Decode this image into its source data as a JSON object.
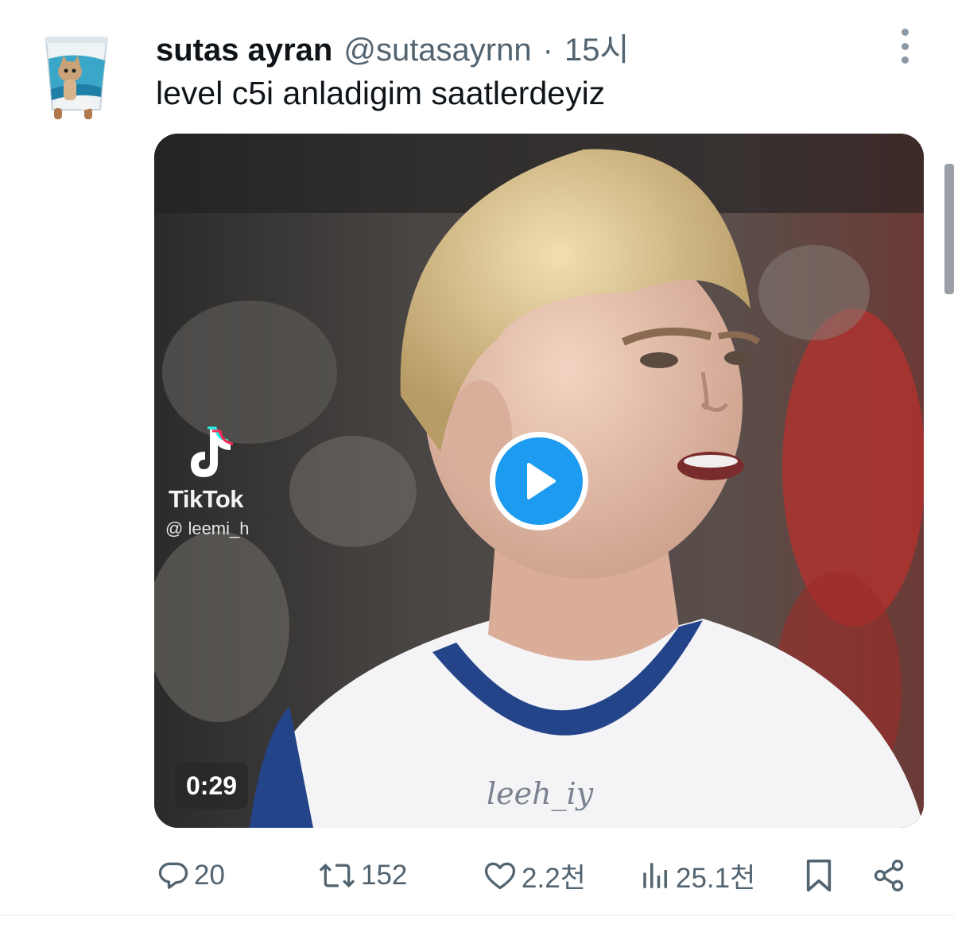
{
  "tweet": {
    "display_name": "sutas ayran",
    "handle": "@sutasayrnn",
    "separator": "·",
    "time": "15시",
    "text": "level c5i anladigim saatlerdeyiz"
  },
  "media": {
    "tiktok_label": "TikTok",
    "tiktok_handle": "@ leemi_h",
    "watermark": "leeh_iy",
    "duration": "0:29",
    "play_color": "#1d9bf0"
  },
  "actions": {
    "reply_count": "20",
    "retweet_count": "152",
    "like_count": "2.2천",
    "view_count": "25.1천"
  },
  "icons": [
    "more-icon",
    "tiktok-logo-icon",
    "play-icon",
    "reply-icon",
    "retweet-icon",
    "like-icon",
    "views-icon",
    "bookmark-icon",
    "share-icon"
  ]
}
